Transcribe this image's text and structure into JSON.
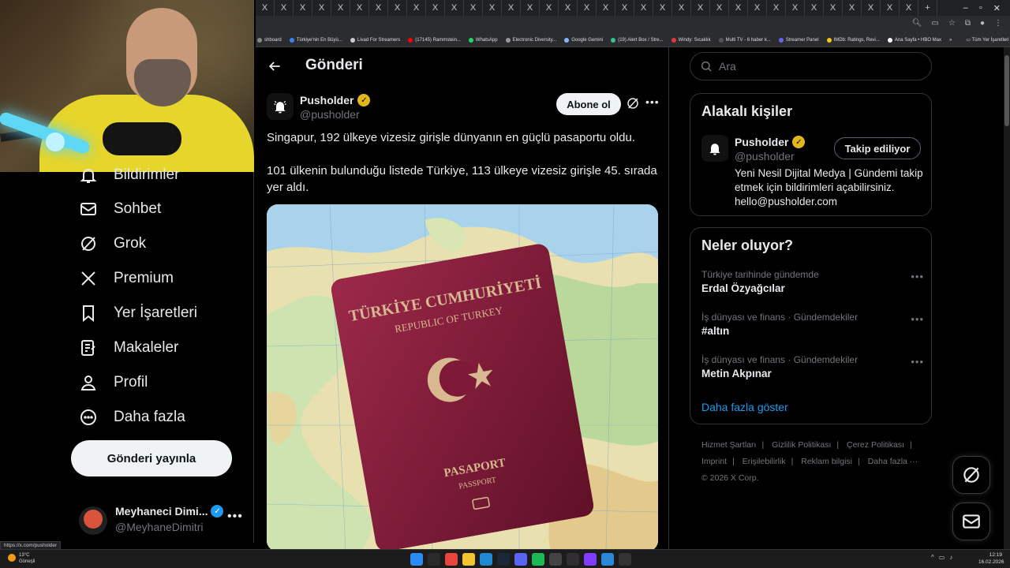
{
  "browser": {
    "tab_glyph": "X",
    "tab_count": 35,
    "new_tab": "+",
    "window_controls": [
      "–",
      "▫",
      "✕"
    ],
    "bookmarks": [
      {
        "label": "shboard",
        "color": "#888888"
      },
      {
        "label": "Türkiye'nin En Büyü...",
        "color": "#3b82f6"
      },
      {
        "label": "Livad For Streamers",
        "color": "#cccccc"
      },
      {
        "label": "(17145) Rammstein...",
        "color": "#ff0000"
      },
      {
        "label": "WhatsApp",
        "color": "#25d366"
      },
      {
        "label": "Electronic Diversity...",
        "color": "#999999"
      },
      {
        "label": "Google Gemini",
        "color": "#8ab4f8"
      },
      {
        "label": "(19) Alert Box / Stre...",
        "color": "#31c48d"
      },
      {
        "label": "Windy: Sıcaklık",
        "color": "#e53935"
      },
      {
        "label": "Multi TV - 6 haber k...",
        "color": "#555555"
      },
      {
        "label": "Streamer Panel",
        "color": "#6366f1"
      },
      {
        "label": "IMDb: Ratings, Revi...",
        "color": "#f5c518"
      },
      {
        "label": "Ana Sayfa • HBO Max",
        "color": "#ffffff"
      }
    ],
    "bookmarks_overflow": "»",
    "all_bookmarks": "Tüm Yer İşaretleri",
    "status_url": "https://x.com/pusholder"
  },
  "sidebar": {
    "items": [
      {
        "label": "Bildirimler",
        "icon": "bell-icon"
      },
      {
        "label": "Sohbet",
        "icon": "mail-icon"
      },
      {
        "label": "Grok",
        "icon": "grok-icon"
      },
      {
        "label": "Premium",
        "icon": "x-logo-icon"
      },
      {
        "label": "Yer İşaretleri",
        "icon": "bookmark-icon"
      },
      {
        "label": "Makaleler",
        "icon": "article-icon"
      },
      {
        "label": "Profil",
        "icon": "person-icon"
      },
      {
        "label": "Daha fazla",
        "icon": "more-circle-icon"
      }
    ],
    "post_button": "Gönderi yayınla",
    "account": {
      "name": "Meyhaneci Dimi...",
      "handle": "@MeyhaneDimitri",
      "more": "•••"
    }
  },
  "main": {
    "header_title": "Gönderi",
    "post": {
      "author_name": "Pusholder",
      "author_handle": "@pusholder",
      "subscribe_label": "Abone ol",
      "more": "•••",
      "text_line1": "Singapur, 192 ülkeye vizesiz girişle dünyanın en güçlü pasaportu oldu.",
      "text_line2": "101 ülkenin bulunduğu listede Türkiye, 113 ülkeye vizesiz girişle 45. sırada yer aldı.",
      "passport_title": "TÜRKİYE CUMHURİYETİ",
      "passport_subtitle": "REPUBLIC OF TURKEY",
      "passport_label": "PASAPORT",
      "passport_label_en": "PASSPORT"
    }
  },
  "right": {
    "search_placeholder": "Ara",
    "related": {
      "title": "Alakalı kişiler",
      "name": "Pusholder",
      "handle": "@pusholder",
      "follow_label": "Takip ediliyor",
      "bio": "Yeni Nesil Dijital Medya | Gündemi takip etmek için bildirimleri açabilirsiniz. hello@pusholder.com"
    },
    "trends": {
      "title": "Neler oluyor?",
      "items": [
        {
          "context": "Türkiye tarihinde gündemde",
          "topic": "Erdal Özyağcılar"
        },
        {
          "context": "İş dünyası ve finans · Gündemdekiler",
          "topic": "#altın"
        },
        {
          "context": "İş dünyası ve finans · Gündemdekiler",
          "topic": "Metin Akpınar"
        }
      ],
      "more": "•••",
      "show_more": "Daha fazla göster"
    },
    "footer": {
      "links": [
        "Hizmet Şartları",
        "Gizlilik Politikası",
        "Çerez Politikası",
        "Imprint",
        "Erişilebilirlik",
        "Reklam bilgisi",
        "Daha fazla ···"
      ],
      "copyright": "© 2026 X Corp."
    }
  },
  "taskbar": {
    "weather_temp": "13°C",
    "weather_desc": "Güneşli",
    "time": "12:19",
    "date": "16.02.2026",
    "apps": [
      {
        "name": "windows-start-icon",
        "color": "#2b8bf2"
      },
      {
        "name": "search-icon",
        "color": "#2a2a2a"
      },
      {
        "name": "chrome-icon",
        "color": "#e8453c"
      },
      {
        "name": "file-explorer-icon",
        "color": "#f4c430"
      },
      {
        "name": "edge-icon",
        "color": "#1f8ad2"
      },
      {
        "name": "steam-icon",
        "color": "#1b2838"
      },
      {
        "name": "discord-icon",
        "color": "#5865f2"
      },
      {
        "name": "spotify-icon",
        "color": "#1db954"
      },
      {
        "name": "app-icon",
        "color": "#444444"
      },
      {
        "name": "obs-icon",
        "color": "#302e31"
      },
      {
        "name": "app-icon-2",
        "color": "#7d3cff"
      },
      {
        "name": "app-icon-3",
        "color": "#2b88d8"
      },
      {
        "name": "grok-taskbar-icon",
        "color": "#333333"
      }
    ]
  },
  "colors": {
    "accent": "#1d9bf0",
    "verified_gold": "#e2b719",
    "passport": "#8e1f3e"
  }
}
